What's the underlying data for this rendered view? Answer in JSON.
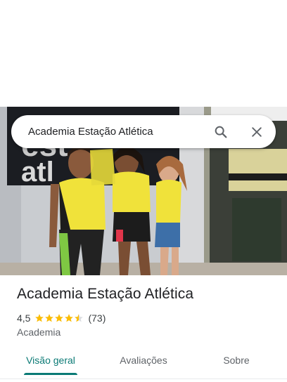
{
  "search": {
    "query": "Academia Estação Atlética",
    "search_icon": "search-icon",
    "close_icon": "close-icon"
  },
  "photo": {
    "sign_text_top": "est",
    "sign_text_bottom": "atl"
  },
  "place": {
    "name": "Academia Estação Atlética",
    "rating": "4,5",
    "rating_value": 4.5,
    "reviews": "(73)",
    "category": "Academia"
  },
  "tabs": [
    {
      "label": "Visão geral",
      "active": true
    },
    {
      "label": "Avaliações",
      "active": false
    },
    {
      "label": "Sobre",
      "active": false
    }
  ],
  "colors": {
    "accent": "#0b7a75",
    "star": "#fbbc04"
  }
}
